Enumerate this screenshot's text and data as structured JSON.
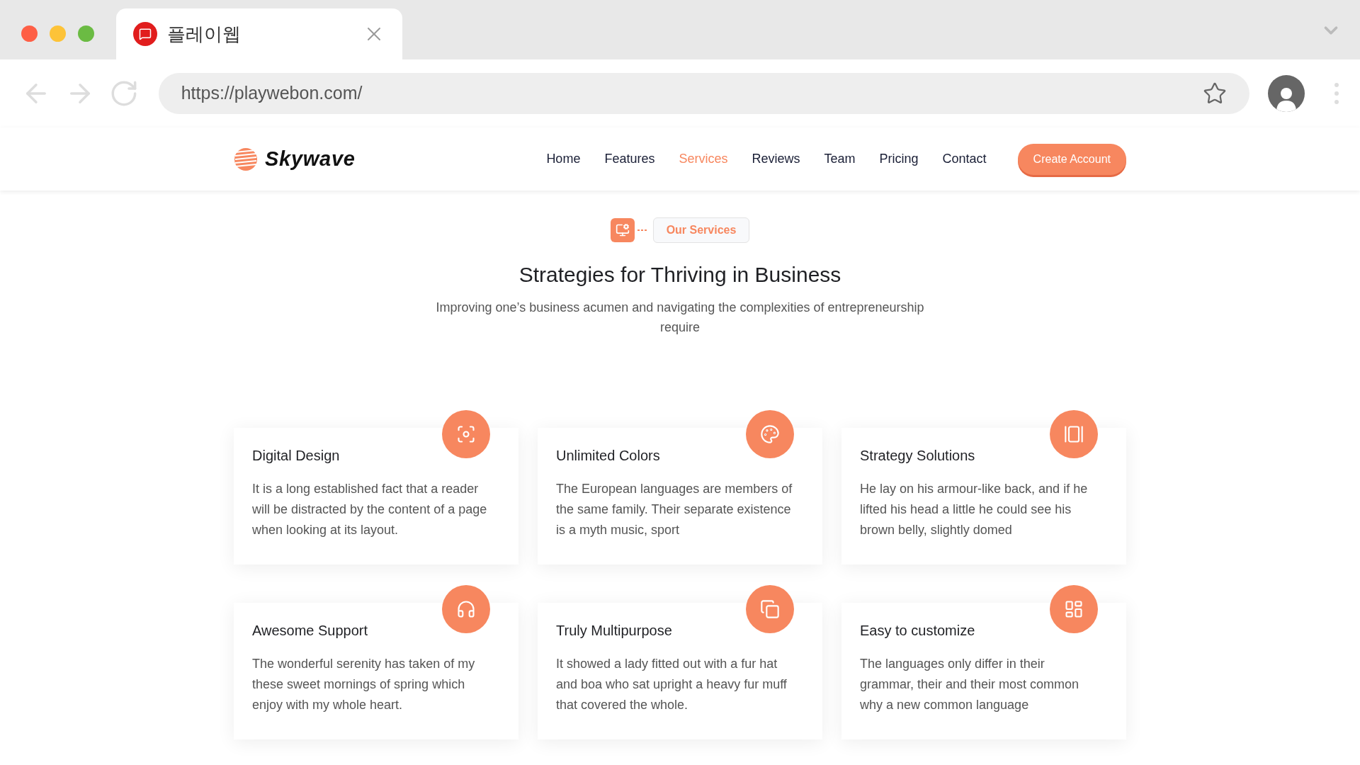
{
  "browser": {
    "tab_title": "플레이웹",
    "url": "https://playwebon.com/"
  },
  "site": {
    "logo": "Skywave",
    "nav": [
      {
        "label": "Home",
        "selected": false
      },
      {
        "label": "Features",
        "selected": false
      },
      {
        "label": "Services",
        "selected": true
      },
      {
        "label": "Reviews",
        "selected": false
      },
      {
        "label": "Team",
        "selected": false
      },
      {
        "label": "Pricing",
        "selected": false
      },
      {
        "label": "Contact",
        "selected": false
      }
    ],
    "cta": "Create Account"
  },
  "section": {
    "badge": "Our Services",
    "title": "Strategies for Thriving in Business",
    "subtitle": "Improving one’s business acumen and navigating the complexities of entrepreneurship require",
    "cards": [
      {
        "title": "Digital Design",
        "text": "It is a long established fact that a reader will be distracted by the content of a page when looking at its layout."
      },
      {
        "title": "Unlimited Colors",
        "text": "The European languages are members of the same family. Their separate existence is a myth music, sport"
      },
      {
        "title": "Strategy Solutions",
        "text": "He lay on his armour-like back, and if he lifted his head a little he could see his brown belly, slightly domed"
      },
      {
        "title": "Awesome Support",
        "text": "The wonderful serenity has taken of my these sweet mornings of spring which enjoy with my whole heart."
      },
      {
        "title": "Truly Multipurpose",
        "text": "It showed a lady fitted out with a fur hat and boa who sat upright a heavy fur muff that covered the whole."
      },
      {
        "title": "Easy to customize",
        "text": "The languages only differ in their grammar, their and their most common why a new common language"
      }
    ]
  }
}
